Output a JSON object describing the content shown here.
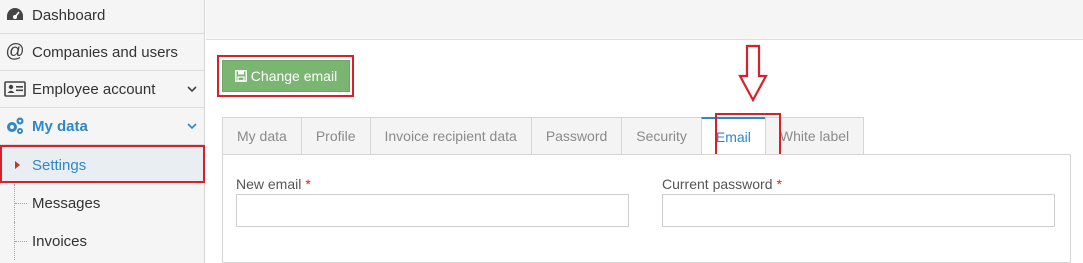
{
  "sidebar": {
    "items": [
      {
        "label": "Dashboard",
        "icon": "dashboard-icon"
      },
      {
        "label": "Companies and users",
        "icon": "at-icon"
      },
      {
        "label": "Employee account",
        "icon": "id-card-icon"
      },
      {
        "label": "My data",
        "icon": "gears-icon"
      }
    ],
    "subitems": [
      {
        "label": "Settings"
      },
      {
        "label": "Messages"
      },
      {
        "label": "Invoices"
      }
    ]
  },
  "toolbar": {
    "change_email_label": "Change email",
    "change_email_icon": "save-icon"
  },
  "tabs": [
    {
      "label": "My data"
    },
    {
      "label": "Profile"
    },
    {
      "label": "Invoice recipient data"
    },
    {
      "label": "Password"
    },
    {
      "label": "Security"
    },
    {
      "label": "Email"
    },
    {
      "label": "White label"
    }
  ],
  "form": {
    "new_email": {
      "label": "New email",
      "required": "*",
      "value": ""
    },
    "current_password": {
      "label": "Current password",
      "required": "*",
      "value": ""
    }
  },
  "colors": {
    "accent": "#2e87c8",
    "button_green": "#7ab572",
    "highlight_red": "#d8202a"
  }
}
